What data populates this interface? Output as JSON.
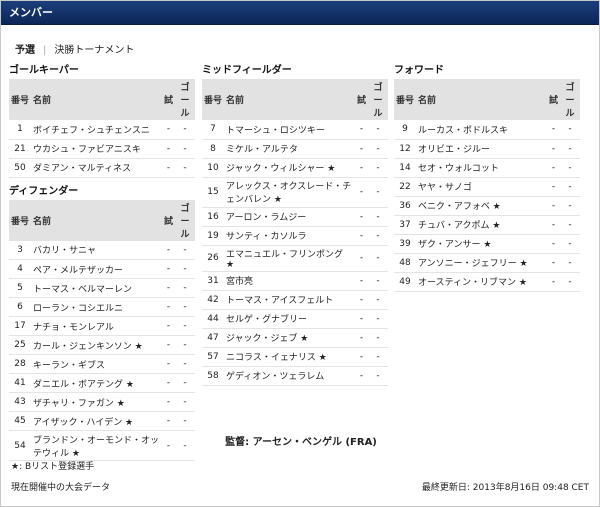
{
  "header": {
    "title": "メンバー"
  },
  "tabs": [
    {
      "label": "予選",
      "active": true
    },
    {
      "label": "決勝トーナメント",
      "active": false
    }
  ],
  "columns": {
    "number": "番号",
    "name": "名前",
    "matches": "試",
    "goals": "ゴール"
  },
  "sections": {
    "goalkeepers": {
      "title": "ゴールキーパー",
      "players": [
        {
          "number": "1",
          "name": "ボイチェフ・シュチェンスニ",
          "matches": "-",
          "goals": "-"
        },
        {
          "number": "21",
          "name": "ウカシュ・ファビアニスキ",
          "matches": "-",
          "goals": "-"
        },
        {
          "number": "50",
          "name": "ダミアン・マルティネス",
          "matches": "-",
          "goals": "-"
        }
      ]
    },
    "defenders": {
      "title": "ディフェンダー",
      "players": [
        {
          "number": "3",
          "name": "バカリ・サニャ",
          "matches": "-",
          "goals": "-"
        },
        {
          "number": "4",
          "name": "ペア・メルテザッカー",
          "matches": "-",
          "goals": "-"
        },
        {
          "number": "5",
          "name": "トーマス・ベルマーレン",
          "matches": "-",
          "goals": "-"
        },
        {
          "number": "6",
          "name": "ローラン・コシエルニ",
          "matches": "-",
          "goals": "-"
        },
        {
          "number": "17",
          "name": "ナチョ・モンレアル",
          "matches": "-",
          "goals": "-"
        },
        {
          "number": "25",
          "name": "カール・ジェンキンソン ★",
          "matches": "-",
          "goals": "-"
        },
        {
          "number": "28",
          "name": "キーラン・ギブス",
          "matches": "-",
          "goals": "-"
        },
        {
          "number": "41",
          "name": "ダニエル・ボアテング ★",
          "matches": "-",
          "goals": "-"
        },
        {
          "number": "43",
          "name": "ザチャリ・ファガン ★",
          "matches": "-",
          "goals": "-"
        },
        {
          "number": "45",
          "name": "アイザック・ハイデン ★",
          "matches": "-",
          "goals": "-"
        },
        {
          "number": "54",
          "name": "ブランドン・オーモンド・オッテウィル ★",
          "matches": "-",
          "goals": "-",
          "tall": true
        }
      ]
    },
    "midfielders": {
      "title": "ミッドフィールダー",
      "players": [
        {
          "number": "7",
          "name": "トマーシュ・ロシツキー",
          "matches": "-",
          "goals": "-"
        },
        {
          "number": "8",
          "name": "ミケル・アルテタ",
          "matches": "-",
          "goals": "-"
        },
        {
          "number": "10",
          "name": "ジャック・ウィルシャー ★",
          "matches": "-",
          "goals": "-"
        },
        {
          "number": "15",
          "name": "アレックス・オクスレード・チェンバレン ★",
          "matches": "-",
          "goals": "-",
          "tall": true
        },
        {
          "number": "16",
          "name": "アーロン・ラムジー",
          "matches": "-",
          "goals": "-"
        },
        {
          "number": "19",
          "name": "サンティ・カソルラ",
          "matches": "-",
          "goals": "-"
        },
        {
          "number": "26",
          "name": "エマニュエル・フリンポング ★",
          "matches": "-",
          "goals": "-"
        },
        {
          "number": "31",
          "name": "宮市亮",
          "matches": "-",
          "goals": "-"
        },
        {
          "number": "42",
          "name": "トーマス・アイスフェルト",
          "matches": "-",
          "goals": "-"
        },
        {
          "number": "44",
          "name": "セルゲ・グナブリー",
          "matches": "-",
          "goals": "-"
        },
        {
          "number": "47",
          "name": "ジャック・ジェブ ★",
          "matches": "-",
          "goals": "-"
        },
        {
          "number": "57",
          "name": "ニコラス・イェナリス ★",
          "matches": "-",
          "goals": "-"
        },
        {
          "number": "58",
          "name": "ゲディオン・ツェラレム",
          "matches": "-",
          "goals": "-"
        }
      ]
    },
    "forwards": {
      "title": "フォワード",
      "players": [
        {
          "number": "9",
          "name": "ルーカス・ポドルスキ",
          "matches": "-",
          "goals": "-"
        },
        {
          "number": "12",
          "name": "オリビエ・ジルー",
          "matches": "-",
          "goals": "-"
        },
        {
          "number": "14",
          "name": "セオ・ウォルコット",
          "matches": "-",
          "goals": "-"
        },
        {
          "number": "22",
          "name": "ヤヤ・サノゴ",
          "matches": "-",
          "goals": "-"
        },
        {
          "number": "36",
          "name": "ベニク・アフォベ ★",
          "matches": "-",
          "goals": "-"
        },
        {
          "number": "37",
          "name": "チュバ・アクポム ★",
          "matches": "-",
          "goals": "-"
        },
        {
          "number": "39",
          "name": "ザク・アンサー ★",
          "matches": "-",
          "goals": "-"
        },
        {
          "number": "48",
          "name": "アンソニー・ジェフリー ★",
          "matches": "-",
          "goals": "-"
        },
        {
          "number": "49",
          "name": "オースティン・リブマン ★",
          "matches": "-",
          "goals": "-"
        }
      ]
    }
  },
  "manager": "監督: アーセン・ベンゲル (FRA)",
  "note": "★: Bリスト登録選手",
  "footer": {
    "left": "現在開催中の大会データ",
    "right": "最終更新日: 2013年8月16日 09:48 CET"
  }
}
